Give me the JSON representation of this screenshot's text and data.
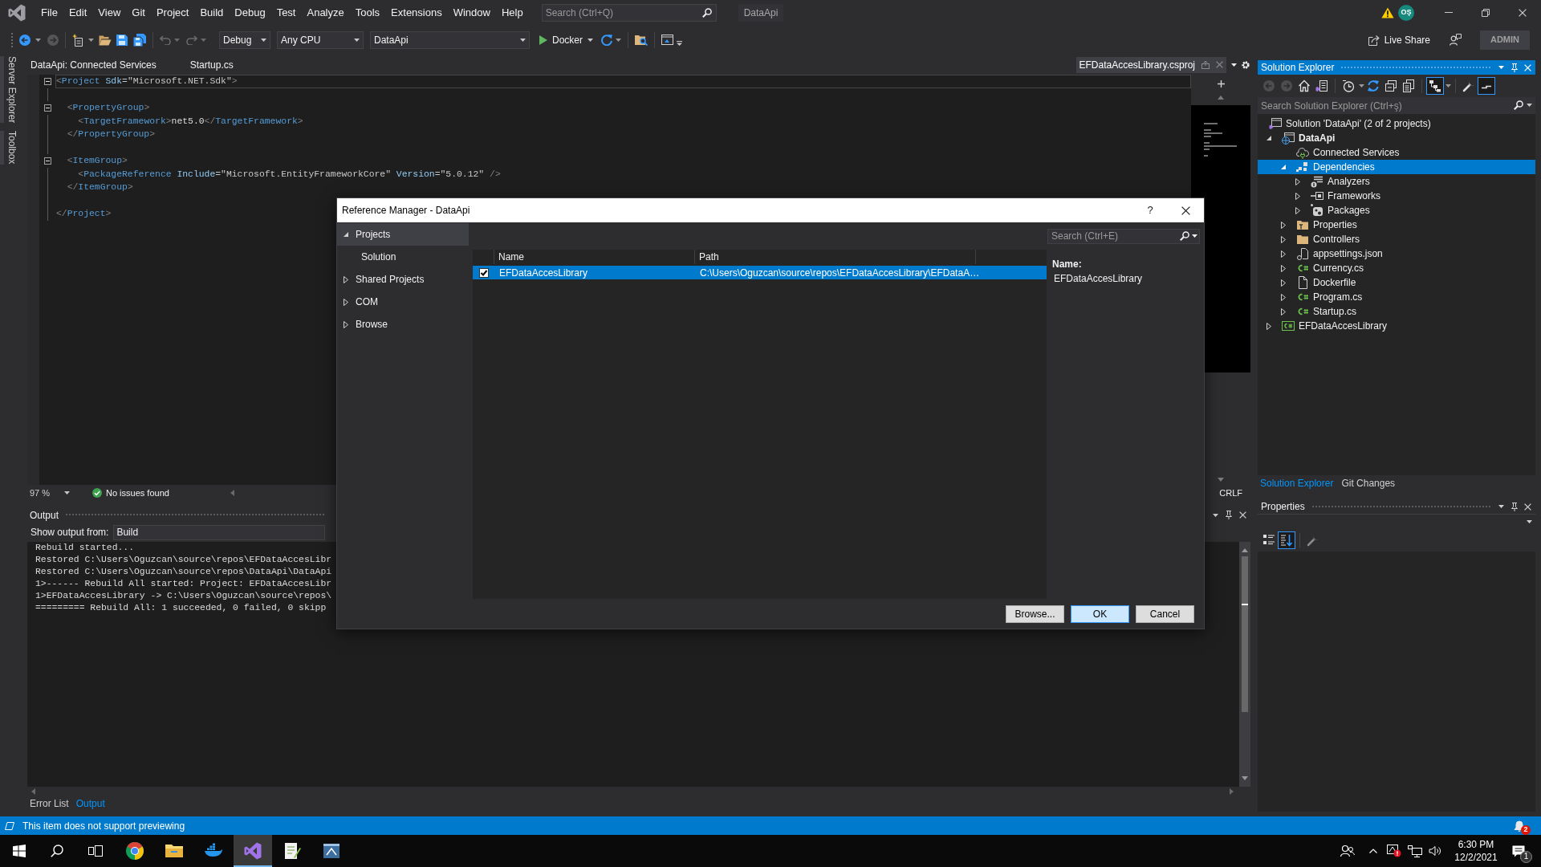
{
  "menu_bar": {
    "items": [
      "File",
      "Edit",
      "View",
      "Git",
      "Project",
      "Build",
      "Debug",
      "Test",
      "Analyze",
      "Tools",
      "Extensions",
      "Window",
      "Help"
    ],
    "search": {
      "placeholder": "Search (Ctrl+Q)"
    },
    "solution_name": "DataApi",
    "account_initials": "OŞ"
  },
  "toolbar": {
    "configuration": "Debug",
    "platform": "Any CPU",
    "startup_item": "DataApi",
    "run_target": "Docker",
    "live_share": "Live Share",
    "account_label": "ADMIN"
  },
  "side_strip": {
    "tabs": [
      "Server Explorer",
      "Toolbox"
    ]
  },
  "document_tabs": [
    {
      "label": "DataApi: Connected Services",
      "kind": "document",
      "selected": false
    },
    {
      "label": "Startup.cs",
      "kind": "document",
      "selected": false
    },
    {
      "label": "EFDataAccesLibrary.csproj",
      "kind": "preview",
      "selected": true
    }
  ],
  "editor": {
    "lines": [
      {
        "kind": "code",
        "foldable": true,
        "current": true,
        "tokens": [
          {
            "kind": "delimiter",
            "text": "<"
          },
          {
            "kind": "element",
            "text": "Project"
          },
          {
            "kind": "attribute",
            "text": " Sdk"
          },
          {
            "kind": "value",
            "text": "=\"Microsoft.NET.Sdk\""
          },
          {
            "kind": "delimiter",
            "text": ">"
          }
        ]
      },
      {
        "kind": "blank"
      },
      {
        "kind": "code",
        "foldable": true,
        "current": false,
        "tokens": [
          {
            "kind": "delimiter",
            "text": "  <"
          },
          {
            "kind": "element",
            "text": "PropertyGroup"
          },
          {
            "kind": "delimiter",
            "text": ">"
          }
        ]
      },
      {
        "kind": "code",
        "foldable": false,
        "current": false,
        "tokens": [
          {
            "kind": "delimiter",
            "text": "    <"
          },
          {
            "kind": "element",
            "text": "TargetFramework"
          },
          {
            "kind": "delimiter",
            "text": ">"
          },
          {
            "kind": "text",
            "text": "net5.0"
          },
          {
            "kind": "delimiter",
            "text": "</"
          },
          {
            "kind": "element",
            "text": "TargetFramework"
          },
          {
            "kind": "delimiter",
            "text": ">"
          }
        ]
      },
      {
        "kind": "code",
        "foldable": false,
        "current": false,
        "tokens": [
          {
            "kind": "delimiter",
            "text": "  </"
          },
          {
            "kind": "element",
            "text": "PropertyGroup"
          },
          {
            "kind": "delimiter",
            "text": ">"
          }
        ]
      },
      {
        "kind": "blank"
      },
      {
        "kind": "code",
        "foldable": true,
        "current": false,
        "tokens": [
          {
            "kind": "delimiter",
            "text": "  <"
          },
          {
            "kind": "element",
            "text": "ItemGroup"
          },
          {
            "kind": "delimiter",
            "text": ">"
          }
        ]
      },
      {
        "kind": "code",
        "foldable": false,
        "current": false,
        "tokens": [
          {
            "kind": "delimiter",
            "text": "    <"
          },
          {
            "kind": "element",
            "text": "PackageReference"
          },
          {
            "kind": "attribute",
            "text": " Include"
          },
          {
            "kind": "value",
            "text": "=\"Microsoft.EntityFrameworkCore\""
          },
          {
            "kind": "attribute",
            "text": " Version"
          },
          {
            "kind": "value",
            "text": "=\"5.0.12\""
          },
          {
            "kind": "delimiter",
            "text": " />"
          }
        ]
      },
      {
        "kind": "code",
        "foldable": false,
        "current": false,
        "tokens": [
          {
            "kind": "delimiter",
            "text": "  </"
          },
          {
            "kind": "element",
            "text": "ItemGroup"
          },
          {
            "kind": "delimiter",
            "text": ">"
          }
        ]
      },
      {
        "kind": "blank"
      },
      {
        "kind": "code",
        "foldable": false,
        "current": false,
        "tokens": [
          {
            "kind": "delimiter",
            "text": "</"
          },
          {
            "kind": "element",
            "text": "Project"
          },
          {
            "kind": "delimiter",
            "text": ">"
          }
        ]
      }
    ],
    "zoom": "97 %",
    "issues": "No issues found",
    "line_ending": "CRLF"
  },
  "output": {
    "title": "Output",
    "source_label": "Show output from:",
    "source": "Build",
    "lines": [
      "Rebuild started...",
      "Restored C:\\Users\\Oguzcan\\source\\repos\\EFDataAccesLibr",
      "Restored C:\\Users\\Oguzcan\\source\\repos\\DataApi\\DataApi",
      "1>------ Rebuild All started: Project: EFDataAccesLibr",
      "1>EFDataAccesLibrary -> C:\\Users\\Oguzcan\\source\\repos\\",
      "========= Rebuild All: 1 succeeded, 0 failed, 0 skipp"
    ]
  },
  "bottom_tabs": [
    {
      "label": "Error List",
      "selected": false
    },
    {
      "label": "Output",
      "selected": true
    }
  ],
  "solution_explorer": {
    "title": "Solution Explorer",
    "toolbar": [
      [
        {
          "kind": "back",
          "on": false
        },
        {
          "kind": "forward",
          "on": false
        },
        {
          "kind": "home",
          "on": false
        },
        {
          "kind": "switch-views",
          "on": false
        }
      ],
      [
        {
          "kind": "history",
          "on": false
        },
        {
          "kind": "sync",
          "on": false
        },
        {
          "kind": "collapse",
          "on": false
        },
        {
          "kind": "copy",
          "on": false
        }
      ],
      [
        {
          "kind": "show-all",
          "on": true
        }
      ],
      [
        {
          "kind": "properties",
          "on": false
        },
        {
          "kind": "preview",
          "on": true
        }
      ]
    ],
    "search": {
      "placeholder": "Search Solution Explorer (Ctrl+ş)"
    },
    "tree": [
      {
        "label": "Solution 'DataApi' (2 of 2 projects)",
        "kind": "solution",
        "selected": false,
        "children": [
          {
            "label": "DataApi",
            "kind": "startup-project",
            "expanded": true,
            "selected": false,
            "children": [
              {
                "label": "Connected Services",
                "kind": "connected-services",
                "selected": false
              },
              {
                "label": "Dependencies",
                "kind": "dependencies",
                "expanded": true,
                "selected": true,
                "children": [
                  {
                    "label": "Analyzers",
                    "kind": "analyzers",
                    "expanded": false,
                    "selected": false
                  },
                  {
                    "label": "Frameworks",
                    "kind": "frameworks",
                    "expanded": false,
                    "selected": false
                  },
                  {
                    "label": "Packages",
                    "kind": "packages",
                    "expanded": false,
                    "selected": false
                  }
                ]
              },
              {
                "label": "Properties",
                "kind": "properties-folder",
                "expanded": false,
                "selected": false
              },
              {
                "label": "Controllers",
                "kind": "folder",
                "expanded": false,
                "selected": false
              },
              {
                "label": "appsettings.json",
                "kind": "json-file",
                "expanded": false,
                "selected": false
              },
              {
                "label": "Currency.cs",
                "kind": "csharp-file",
                "expanded": false,
                "selected": false
              },
              {
                "label": "Dockerfile",
                "kind": "file",
                "expanded": false,
                "selected": false
              },
              {
                "label": "Program.cs",
                "kind": "csharp-file",
                "expanded": false,
                "selected": false
              },
              {
                "label": "Startup.cs",
                "kind": "csharp-file",
                "expanded": false,
                "selected": false
              }
            ]
          },
          {
            "label": "EFDataAccesLibrary",
            "kind": "csharp-project",
            "expanded": false,
            "selected": false
          }
        ]
      }
    ],
    "tabs": [
      {
        "label": "Solution Explorer",
        "selected": true
      },
      {
        "label": "Git Changes",
        "selected": false
      }
    ]
  },
  "properties": {
    "title": "Properties",
    "toolbar": [
      [
        {
          "kind": "categorized",
          "on": false
        },
        {
          "kind": "alphabetical",
          "on": true
        }
      ],
      [
        {
          "kind": "property-pages",
          "on": false
        }
      ]
    ]
  },
  "dialog": {
    "title": "Reference Manager - DataApi",
    "help": "?",
    "nav": [
      {
        "label": "Projects",
        "expanded": true,
        "selected": true,
        "children": [
          {
            "label": "Solution",
            "selected": false
          }
        ]
      },
      {
        "label": "Shared Projects",
        "expanded": false,
        "selected": false
      },
      {
        "label": "COM",
        "expanded": false,
        "selected": false
      },
      {
        "label": "Browse",
        "expanded": false,
        "selected": false
      }
    ],
    "search": {
      "placeholder": "Search (Ctrl+E)"
    },
    "columns": [
      "Name",
      "Path"
    ],
    "rows": [
      {
        "name": "EFDataAccesLibrary",
        "path": "C:\\Users\\Oguzcan\\source\\repos\\EFDataAccesLibrary\\EFDataA…",
        "checked": true,
        "selected": true
      }
    ],
    "details": {
      "label": "Name:",
      "value": "EFDataAccesLibrary"
    },
    "buttons": [
      {
        "label": "Browse...",
        "default": false
      },
      {
        "label": "OK",
        "default": true
      },
      {
        "label": "Cancel",
        "default": false
      }
    ]
  },
  "status_bar": {
    "message": "This item does not support previewing",
    "notification_count": "2"
  },
  "taskbar": {
    "apps": [
      {
        "kind": "browser",
        "active": false
      },
      {
        "kind": "file-explorer",
        "active": false
      },
      {
        "kind": "whale",
        "active": false
      },
      {
        "kind": "ide",
        "active": true
      },
      {
        "kind": "notepad",
        "active": false
      },
      {
        "kind": "database-tool",
        "active": false
      }
    ],
    "time": "6:30 PM",
    "date": "12/2/2021",
    "notification_count": "1"
  }
}
